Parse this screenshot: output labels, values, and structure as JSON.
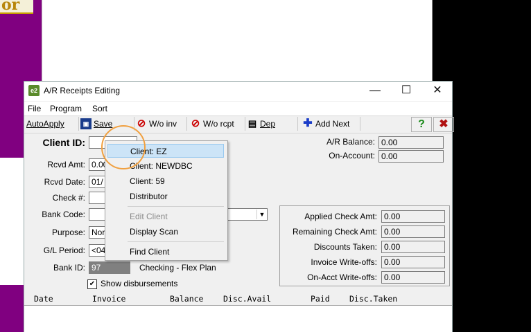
{
  "background": {
    "logo_text": "or"
  },
  "window": {
    "title": "A/R Receipts Editing",
    "app_icon_text": "e2",
    "controls": {
      "minimize": "—",
      "maximize": "☐",
      "close": "✕"
    }
  },
  "menu": {
    "file": "File",
    "program": "Program",
    "sort": "Sort"
  },
  "toolbar": {
    "autoapply": "AutoApply",
    "save": "Save",
    "wo_inv": "W/o inv",
    "wo_rcpt": "W/o rcpt",
    "dep": "Dep",
    "add_next": "Add Next",
    "help": "?",
    "exit": "✖"
  },
  "form": {
    "client_id_label": "Client ID:",
    "client_id_value": "",
    "rcvd_amt_label": "Rcvd Amt:",
    "rcvd_amt_value": "0.00",
    "rcvd_date_label": "Rcvd Date:",
    "rcvd_date_value": "01/",
    "check_label": "Check #:",
    "check_value": "",
    "bank_code_label": "Bank Code:",
    "bank_code_value": "",
    "purpose_label": "Purpose:",
    "purpose_value": "Nor",
    "gl_period_label": "G/L Period:",
    "gl_period_value": "<04",
    "bank_id_label": "Bank ID:",
    "bank_id_value": "97",
    "bank_desc": "Checking - Flex Plan",
    "show_disbursements_label": "Show disbursements",
    "show_disbursements_checked": "✔",
    "ar_balance_label": "A/R Balance:",
    "ar_balance_value": "0.00",
    "on_account_label": "On-Account:",
    "on_account_value": "0.00"
  },
  "summary": {
    "applied_label": "Applied Check Amt:",
    "applied_value": "0.00",
    "remaining_label": "Remaining Check Amt:",
    "remaining_value": "0.00",
    "discounts_label": "Discounts Taken:",
    "discounts_value": "0.00",
    "invoice_wo_label": "Invoice Write-offs:",
    "invoice_wo_value": "0.00",
    "onacct_wo_label": "On-Acct Write-offs:",
    "onacct_wo_value": "0.00"
  },
  "columns": [
    "Date",
    "Invoice",
    "Balance",
    "Disc.Avail",
    "Paid",
    "Disc.Taken"
  ],
  "popup": {
    "items": [
      {
        "label": "Client: EZ",
        "state": "selected"
      },
      {
        "label": "Client: NEWDBC",
        "state": "normal"
      },
      {
        "label": "Client: 59",
        "state": "normal"
      },
      {
        "label": "Distributor",
        "state": "normal"
      },
      {
        "label": "Edit Client",
        "state": "disabled"
      },
      {
        "label": "Display Scan",
        "state": "normal"
      },
      {
        "label": "Find Client",
        "state": "normal"
      }
    ]
  },
  "colors": {
    "highlight_circle": "#f0a040",
    "purple": "#800080"
  }
}
